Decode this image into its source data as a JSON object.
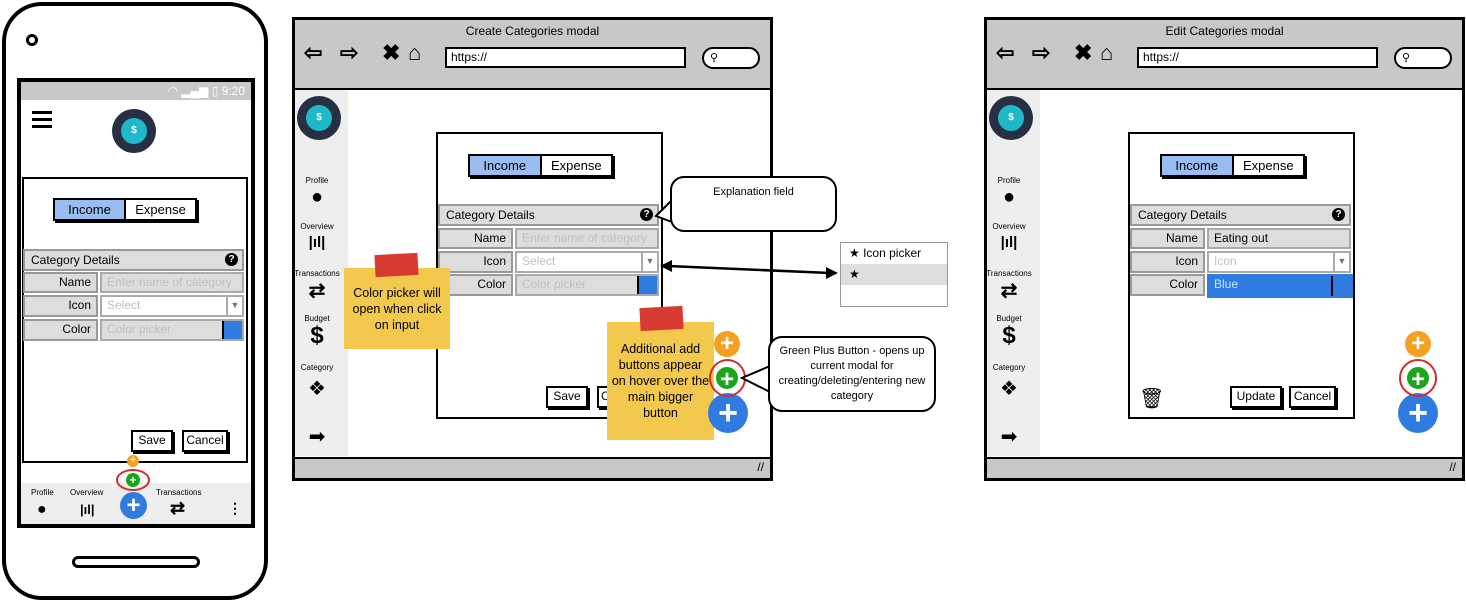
{
  "phone": {
    "status_time": "9:20",
    "logo_symbol": "$",
    "segment": {
      "income": "Income",
      "expense": "Expense",
      "selected": "Income"
    },
    "section_title": "Category Details",
    "fields": {
      "name_label": "Name",
      "name_placeholder": "Enter name of category",
      "icon_label": "Icon",
      "icon_placeholder": "Select",
      "color_label": "Color",
      "color_placeholder": "Color picker"
    },
    "save": "Save",
    "cancel": "Cancel",
    "bottom_nav": [
      {
        "label": "Profile",
        "icon": "user-icon"
      },
      {
        "label": "Overview",
        "icon": "bar-chart-icon"
      },
      {
        "label": "Transactions",
        "icon": "transfer-icon"
      },
      {
        "label": "",
        "icon": "more-vertical-icon"
      }
    ]
  },
  "create_window": {
    "title": "Create Categories modal",
    "url": "https://",
    "sidebar": [
      {
        "label": "Profile",
        "icon": "user-icon"
      },
      {
        "label": "Overview",
        "icon": "bar-chart-icon"
      },
      {
        "label": "Transactions",
        "icon": "transfer-icon"
      },
      {
        "label": "Budget",
        "icon": "dollar-icon"
      },
      {
        "label": "Category",
        "icon": "cubes-icon"
      }
    ],
    "segment": {
      "income": "Income",
      "expense": "Expense",
      "selected": "Income"
    },
    "section_title": "Category Details",
    "fields": {
      "name_label": "Name",
      "name_placeholder": "Enter name of category",
      "icon_label": "Icon",
      "icon_placeholder": "Select",
      "color_label": "Color",
      "color_placeholder": "Color picker"
    },
    "save": "Save",
    "cancel": "C",
    "note_color_picker": "Color picker will open when click on input",
    "note_add_buttons": "Additional add buttons appear on hover over the main bigger button",
    "callout_explanation": "Explanation field",
    "callout_green_plus": "Green Plus Button - opens up current modal for creating/deleting/entering new category",
    "icon_picker": {
      "title": "Icon picker",
      "icon": "star-icon"
    }
  },
  "edit_window": {
    "title": "Edit Categories modal",
    "url": "https://",
    "sidebar": [
      {
        "label": "Profile",
        "icon": "user-icon"
      },
      {
        "label": "Overview",
        "icon": "bar-chart-icon"
      },
      {
        "label": "Transactions",
        "icon": "transfer-icon"
      },
      {
        "label": "Budget",
        "icon": "dollar-icon"
      },
      {
        "label": "Category",
        "icon": "cubes-icon"
      }
    ],
    "segment": {
      "income": "Income",
      "expense": "Expense",
      "selected": "Income"
    },
    "section_title": "Category Details",
    "fields": {
      "name_label": "Name",
      "name_value": "Eating out",
      "icon_label": "Icon",
      "icon_placeholder": "Icon",
      "color_label": "Color",
      "color_value": "Blue"
    },
    "update": "Update",
    "cancel": "Cancel"
  },
  "colors": {
    "accent_blue": "#2f7be0",
    "segment_selected": "#99bdf0",
    "plus_orange": "#f5a020",
    "plus_green": "#1aa51a",
    "note_yellow": "#f2c94c",
    "tape_red": "#d63a30",
    "highlight_ring": "#d42a2a"
  }
}
